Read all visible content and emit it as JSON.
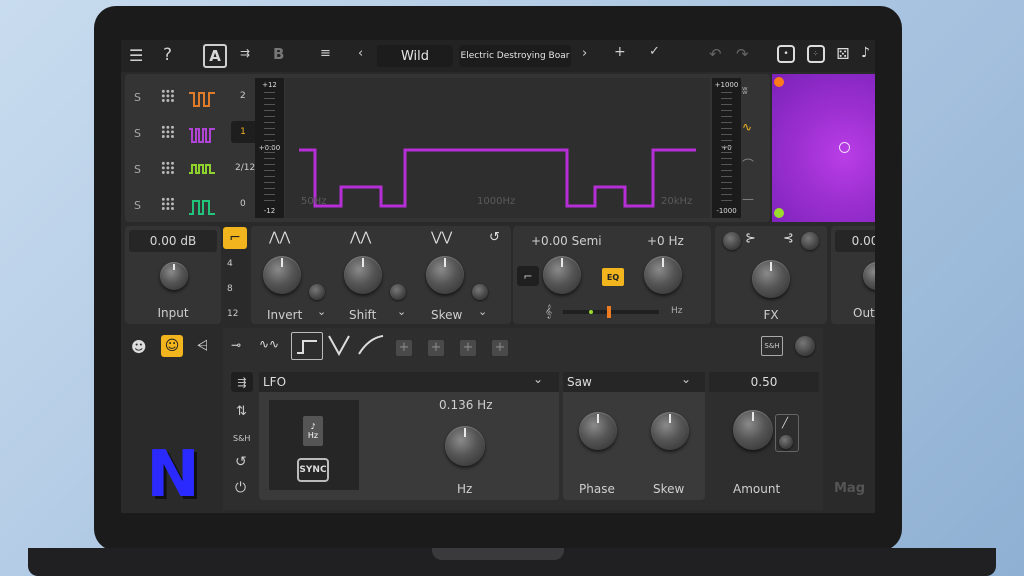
{
  "topbar": {
    "preset_slot_a": "A",
    "preset_slot_b": "B",
    "preset_name": "Wild",
    "preset_title": "Electric Destroying Boar"
  },
  "bands": {
    "items": [
      {
        "solo": "S",
        "value": "2",
        "color": "#e07b2a"
      },
      {
        "solo": "S",
        "value": "1",
        "color": "#b143d6"
      },
      {
        "solo": "S",
        "value": "2/12",
        "color": "#8fd22d"
      },
      {
        "solo": "S",
        "value": "0",
        "color": "#23c27a"
      }
    ],
    "left_meter": {
      "top": "+12",
      "mid": "+0.00",
      "bottom": "-12"
    },
    "right_meter": {
      "top": "+1000",
      "mid": "+0",
      "bottom": "-1000"
    },
    "freq_labels": [
      "50Hz",
      "1000Hz",
      "20kHz"
    ]
  },
  "input": {
    "value": "0.00 dB",
    "label": "Input"
  },
  "dividers": [
    "4",
    "8",
    "12"
  ],
  "mod": {
    "invert": "Invert",
    "shift": "Shift",
    "skew": "Skew"
  },
  "pitch": {
    "semi": "+0.00 Semi",
    "hz": "+0 Hz",
    "eq": "EQ",
    "hz_unit": "Hz"
  },
  "fx": {
    "label": "FX"
  },
  "output": {
    "value": "0.00",
    "label": "Out"
  },
  "lfo": {
    "source": "LFO",
    "shape": "Saw",
    "amount_value": "0.50",
    "rate_value": "0.136 Hz",
    "rate_label": "Hz",
    "phase_label": "Phase",
    "skew_label": "Skew",
    "amount_label": "Amount",
    "sync_label": "SYNC",
    "hz_badge": "Hz",
    "sh_label": "S&H",
    "sh_side_label": "S&H"
  },
  "brand": {
    "logo_letter": "N",
    "footer_text": "Mag"
  },
  "colors": {
    "accent_yellow": "#f3b51d",
    "wave_purple": "#b62fd6",
    "xy_pad": "#9b2fd0"
  }
}
